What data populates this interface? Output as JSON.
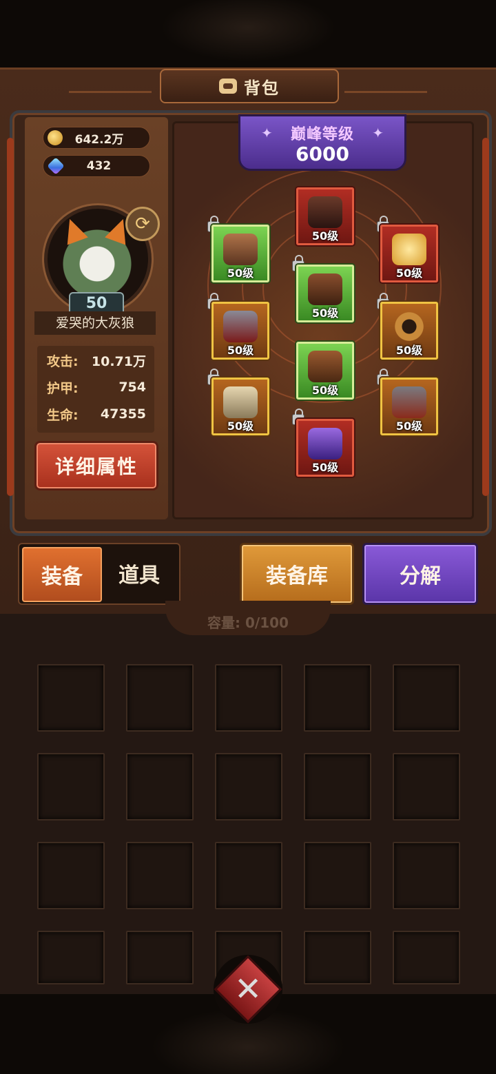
{
  "header": {
    "title": "背包"
  },
  "currency": {
    "gold": "642.2万",
    "gems": "432"
  },
  "player": {
    "level": "50",
    "name": "爱哭的大灰狼",
    "stats": [
      {
        "label": "攻击:",
        "value": "10.71万"
      },
      {
        "label": "护甲:",
        "value": "754"
      },
      {
        "label": "生命:",
        "value": "47355"
      }
    ],
    "detail_button": "详细属性"
  },
  "peak": {
    "title": "巅峰等级",
    "value": "6000"
  },
  "equipment": [
    {
      "slot": "helmet",
      "level": "50级",
      "quality": "red",
      "locked": false
    },
    {
      "slot": "shoulder",
      "level": "50级",
      "quality": "green",
      "locked": true
    },
    {
      "slot": "necklace",
      "level": "50级",
      "quality": "red",
      "locked": true
    },
    {
      "slot": "armor",
      "level": "50级",
      "quality": "green",
      "locked": true
    },
    {
      "slot": "gloves",
      "level": "50级",
      "quality": "orange",
      "locked": true
    },
    {
      "slot": "belt",
      "level": "50级",
      "quality": "orange",
      "locked": true
    },
    {
      "slot": "pants",
      "level": "50级",
      "quality": "green",
      "locked": false
    },
    {
      "slot": "mask",
      "level": "50级",
      "quality": "orange",
      "locked": true
    },
    {
      "slot": "bracer",
      "level": "50级",
      "quality": "orange",
      "locked": true
    },
    {
      "slot": "boots",
      "level": "50级",
      "quality": "red",
      "locked": true
    }
  ],
  "tabs": {
    "equip": "装备",
    "items": "道具"
  },
  "buttons": {
    "library": "装备库",
    "decompose": "分解"
  },
  "inventory": {
    "capacity": "容量:  0/100"
  },
  "colors": {
    "accent_orange": "#e0702f",
    "accent_purple": "#6b44c0",
    "panel_brown": "#4a2b1b"
  }
}
